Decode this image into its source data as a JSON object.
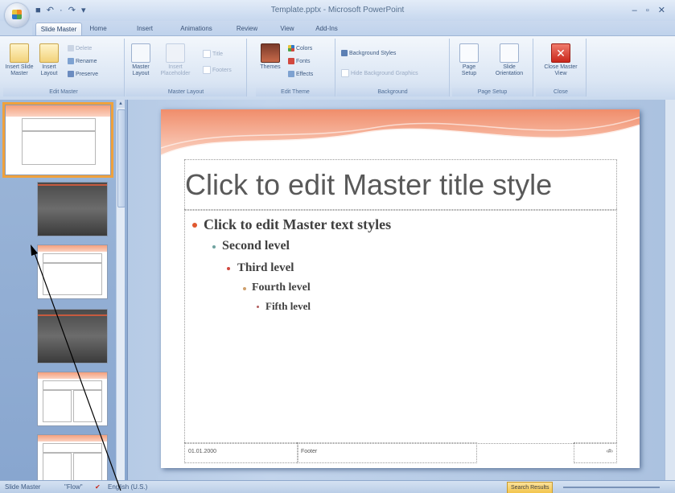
{
  "app": {
    "window_title": "Template.pptx - Microsoft PowerPoint",
    "quick_access": "■ ↶ · ↷ ▾"
  },
  "tabs": [
    {
      "label": "Slide Master",
      "active": true
    },
    {
      "label": "Home"
    },
    {
      "label": "Insert"
    },
    {
      "label": "Animations"
    },
    {
      "label": "Review"
    },
    {
      "label": "View"
    },
    {
      "label": "Add-Ins"
    }
  ],
  "ribbon": {
    "groups": {
      "edit_master": "Edit Master",
      "master_layout": "Master Layout",
      "edit_theme": "Edit Theme",
      "background": "Background",
      "page_setup": "Page Setup",
      "close": "Close"
    },
    "buttons": {
      "insert_slide_master": "Insert Slide Master",
      "insert_layout": "Insert Layout",
      "delete": "Delete",
      "rename": "Rename",
      "preserve": "Preserve",
      "master_layout": "Master Layout",
      "insert_placeholder": "Insert Placeholder",
      "title": "Title",
      "footers": "Footers",
      "themes": "Themes",
      "colors": "Colors",
      "fonts": "Fonts",
      "effects": "Effects",
      "background_styles": "Background Styles",
      "hide_background_graphics": "Hide Background Graphics",
      "page_setup": "Page Setup",
      "slide_orientation": "Slide Orientation",
      "close_master_view": "Close Master View"
    }
  },
  "slide": {
    "title": "Click to edit Master title style",
    "levels": [
      "Click to edit Master text styles",
      "Second level",
      "Third level",
      "Fourth level",
      "Fifth level"
    ],
    "footer_date": "01.01.2000",
    "footer_text": "Footer",
    "footer_number": "‹#›"
  },
  "statusbar": {
    "view": "Slide Master",
    "theme": "\"Flow\"",
    "language": "English (U.S.)",
    "zoom_button": "Search Results"
  },
  "colors": {
    "accent_orange": "#f0a13c",
    "bullet_level1": "#e0582f",
    "bullet_level2": "#6fa3a0",
    "bullet_level3": "#d1483f",
    "bullet_level4": "#cfa06d",
    "bullet_level5": "#b36060"
  }
}
